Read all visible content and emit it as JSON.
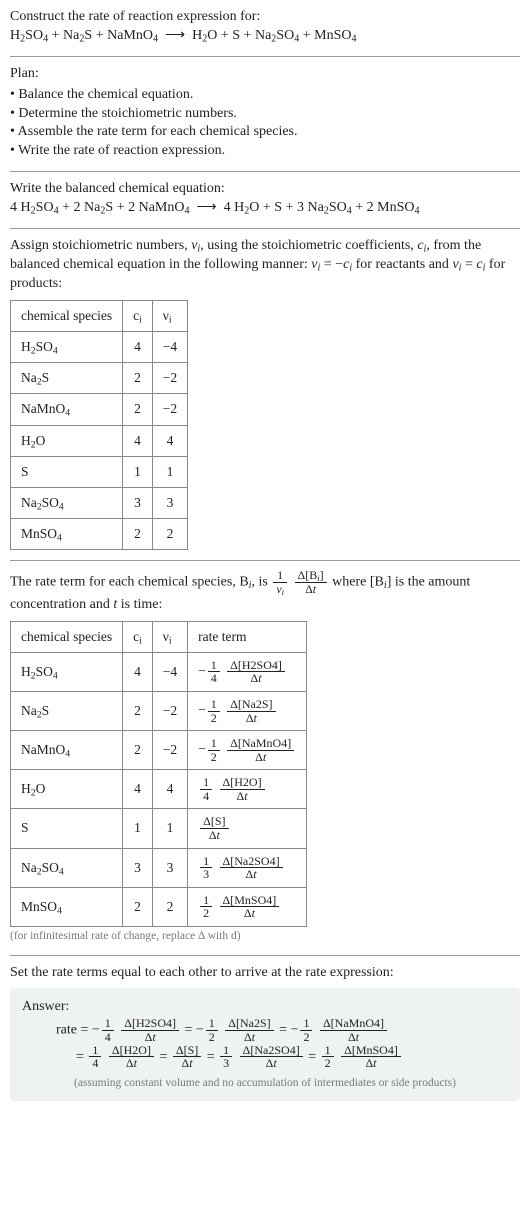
{
  "header": {
    "prompt_line1": "Construct the rate of reaction expression for:",
    "reaction_unbalanced_html": "H<sub>2</sub>SO<sub>4</sub> + Na<sub>2</sub>S + NaMnO<sub>4</sub> &nbsp;⟶&nbsp; H<sub>2</sub>O + S + Na<sub>2</sub>SO<sub>4</sub> + MnSO<sub>4</sub>"
  },
  "plan": {
    "title": "Plan:",
    "items": [
      "• Balance the chemical equation.",
      "• Determine the stoichiometric numbers.",
      "• Assemble the rate term for each chemical species.",
      "• Write the rate of reaction expression."
    ]
  },
  "balanced": {
    "intro": "Write the balanced chemical equation:",
    "reaction_html": "4 H<sub>2</sub>SO<sub>4</sub> + 2 Na<sub>2</sub>S + 2 NaMnO<sub>4</sub> &nbsp;⟶&nbsp; 4 H<sub>2</sub>O + S + 3 Na<sub>2</sub>SO<sub>4</sub> + 2 MnSO<sub>4</sub>"
  },
  "stoich": {
    "intro_html": "Assign stoichiometric numbers, <span class='ital'>ν<sub>i</sub></span>, using the stoichiometric coefficients, <span class='ital'>c<sub>i</sub></span>, from the balanced chemical equation in the following manner: <span class='ital'>ν<sub>i</sub></span> = −<span class='ital'>c<sub>i</sub></span> for reactants and <span class='ital'>ν<sub>i</sub></span> = <span class='ital'>c<sub>i</sub></span> for products:",
    "headers": {
      "species": "chemical species",
      "ci": "c<sub>i</sub>",
      "vi": "ν<sub>i</sub>"
    },
    "rows": [
      {
        "species_html": "H<sub>2</sub>SO<sub>4</sub>",
        "ci": "4",
        "vi": "−4"
      },
      {
        "species_html": "Na<sub>2</sub>S",
        "ci": "2",
        "vi": "−2"
      },
      {
        "species_html": "NaMnO<sub>4</sub>",
        "ci": "2",
        "vi": "−2"
      },
      {
        "species_html": "H<sub>2</sub>O",
        "ci": "4",
        "vi": "4"
      },
      {
        "species_html": "S",
        "ci": "1",
        "vi": "1"
      },
      {
        "species_html": "Na<sub>2</sub>SO<sub>4</sub>",
        "ci": "3",
        "vi": "3"
      },
      {
        "species_html": "MnSO<sub>4</sub>",
        "ci": "2",
        "vi": "2"
      }
    ]
  },
  "rateterm": {
    "intro_html": "The rate term for each chemical species, B<sub><span class='ital'>i</span></sub>, is <span class='frac'><span class='num'>1</span><span class='den'><span class='ital'>ν<sub>i</sub></span></span></span> <span class='frac'><span class='num'>Δ[B<sub><span class='ital'>i</span></sub>]</span><span class='den'>Δ<span class='ital'>t</span></span></span> where [B<sub><span class='ital'>i</span></sub>] is the amount concentration and <span class='ital'>t</span> is time:",
    "headers": {
      "species": "chemical species",
      "ci": "c<sub>i</sub>",
      "vi": "ν<sub>i</sub>",
      "rate": "rate term"
    },
    "rows": [
      {
        "species_html": "H<sub>2</sub>SO<sub>4</sub>",
        "ci": "4",
        "vi": "−4",
        "rate_html": "−<span class='frac'><span class='num'>1</span><span class='den'>4</span></span> <span class='frac'><span class='num'>Δ[H2SO4]</span><span class='den'>Δ<span class='ital'>t</span></span></span>"
      },
      {
        "species_html": "Na<sub>2</sub>S",
        "ci": "2",
        "vi": "−2",
        "rate_html": "−<span class='frac'><span class='num'>1</span><span class='den'>2</span></span> <span class='frac'><span class='num'>Δ[Na2S]</span><span class='den'>Δ<span class='ital'>t</span></span></span>"
      },
      {
        "species_html": "NaMnO<sub>4</sub>",
        "ci": "2",
        "vi": "−2",
        "rate_html": "−<span class='frac'><span class='num'>1</span><span class='den'>2</span></span> <span class='frac'><span class='num'>Δ[NaMnO4]</span><span class='den'>Δ<span class='ital'>t</span></span></span>"
      },
      {
        "species_html": "H<sub>2</sub>O",
        "ci": "4",
        "vi": "4",
        "rate_html": "<span class='frac'><span class='num'>1</span><span class='den'>4</span></span> <span class='frac'><span class='num'>Δ[H2O]</span><span class='den'>Δ<span class='ital'>t</span></span></span>"
      },
      {
        "species_html": "S",
        "ci": "1",
        "vi": "1",
        "rate_html": "<span class='frac'><span class='num'>Δ[S]</span><span class='den'>Δ<span class='ital'>t</span></span></span>"
      },
      {
        "species_html": "Na<sub>2</sub>SO<sub>4</sub>",
        "ci": "3",
        "vi": "3",
        "rate_html": "<span class='frac'><span class='num'>1</span><span class='den'>3</span></span> <span class='frac'><span class='num'>Δ[Na2SO4]</span><span class='den'>Δ<span class='ital'>t</span></span></span>"
      },
      {
        "species_html": "MnSO<sub>4</sub>",
        "ci": "2",
        "vi": "2",
        "rate_html": "<span class='frac'><span class='num'>1</span><span class='den'>2</span></span> <span class='frac'><span class='num'>Δ[MnSO4]</span><span class='den'>Δ<span class='ital'>t</span></span></span>"
      }
    ],
    "footnote": "(for infinitesimal rate of change, replace Δ with d)"
  },
  "final": {
    "intro": "Set the rate terms equal to each other to arrive at the rate expression:"
  },
  "answer": {
    "label": "Answer:",
    "line1_html": "rate = −<span class='frac'><span class='num'>1</span><span class='den'>4</span></span> <span class='frac'><span class='num'>Δ[H2SO4]</span><span class='den'>Δ<span class='ital'>t</span></span></span> = −<span class='frac'><span class='num'>1</span><span class='den'>2</span></span> <span class='frac'><span class='num'>Δ[Na2S]</span><span class='den'>Δ<span class='ital'>t</span></span></span> = −<span class='frac'><span class='num'>1</span><span class='den'>2</span></span> <span class='frac'><span class='num'>Δ[NaMnO4]</span><span class='den'>Δ<span class='ital'>t</span></span></span>",
    "line2_html": "= <span class='frac'><span class='num'>1</span><span class='den'>4</span></span> <span class='frac'><span class='num'>Δ[H2O]</span><span class='den'>Δ<span class='ital'>t</span></span></span> = <span class='frac'><span class='num'>Δ[S]</span><span class='den'>Δ<span class='ital'>t</span></span></span> = <span class='frac'><span class='num'>1</span><span class='den'>3</span></span> <span class='frac'><span class='num'>Δ[Na2SO4]</span><span class='den'>Δ<span class='ital'>t</span></span></span> = <span class='frac'><span class='num'>1</span><span class='den'>2</span></span> <span class='frac'><span class='num'>Δ[MnSO4]</span><span class='den'>Δ<span class='ital'>t</span></span></span>",
    "note": "(assuming constant volume and no accumulation of intermediates or side products)"
  },
  "chart_data": {
    "type": "table",
    "tables": [
      {
        "title": "Stoichiometric numbers",
        "columns": [
          "chemical species",
          "c_i",
          "ν_i"
        ],
        "rows": [
          [
            "H2SO4",
            4,
            -4
          ],
          [
            "Na2S",
            2,
            -2
          ],
          [
            "NaMnO4",
            2,
            -2
          ],
          [
            "H2O",
            4,
            4
          ],
          [
            "S",
            1,
            1
          ],
          [
            "Na2SO4",
            3,
            3
          ],
          [
            "MnSO4",
            2,
            2
          ]
        ]
      },
      {
        "title": "Rate terms",
        "columns": [
          "chemical species",
          "c_i",
          "ν_i",
          "rate term"
        ],
        "rows": [
          [
            "H2SO4",
            4,
            -4,
            "-(1/4) Δ[H2SO4]/Δt"
          ],
          [
            "Na2S",
            2,
            -2,
            "-(1/2) Δ[Na2S]/Δt"
          ],
          [
            "NaMnO4",
            2,
            -2,
            "-(1/2) Δ[NaMnO4]/Δt"
          ],
          [
            "H2O",
            4,
            4,
            "(1/4) Δ[H2O]/Δt"
          ],
          [
            "S",
            1,
            1,
            "Δ[S]/Δt"
          ],
          [
            "Na2SO4",
            3,
            3,
            "(1/3) Δ[Na2SO4]/Δt"
          ],
          [
            "MnSO4",
            2,
            2,
            "(1/2) Δ[MnSO4]/Δt"
          ]
        ]
      }
    ]
  }
}
